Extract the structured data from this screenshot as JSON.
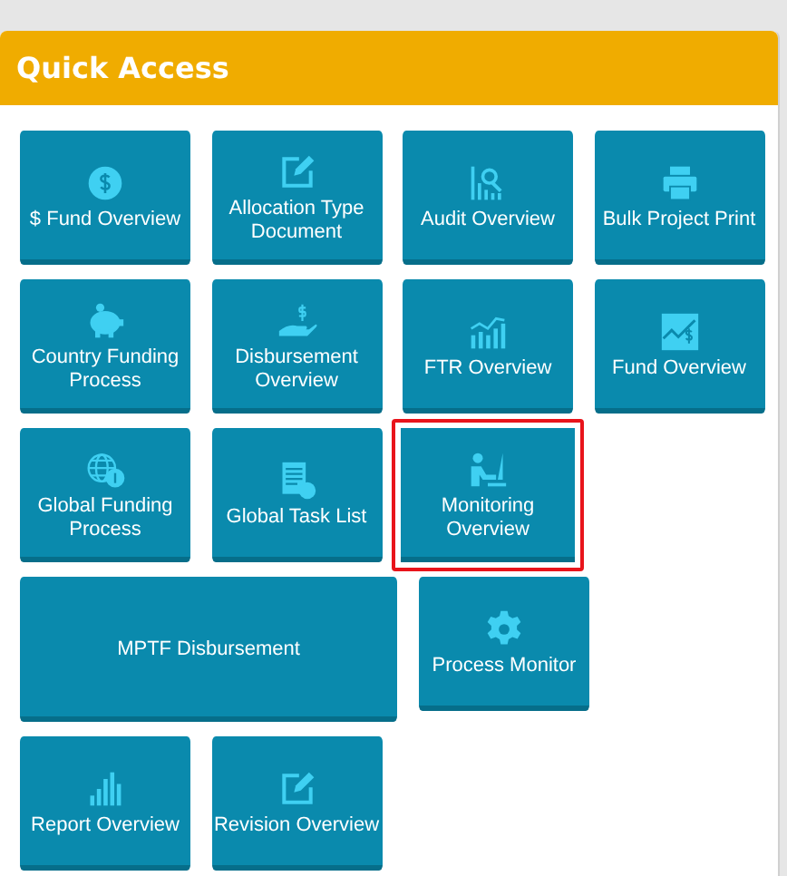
{
  "panel": {
    "title": "Quick Access"
  },
  "rows": [
    [
      {
        "label": "$ Fund Overview",
        "kind": "standard",
        "selected": false
      },
      {
        "label": "Allocation Type Document",
        "kind": "standard",
        "selected": false
      },
      {
        "label": "Audit Overview",
        "kind": "standard",
        "selected": false
      },
      {
        "label": "Bulk Project Print",
        "kind": "standard",
        "selected": false
      }
    ],
    [
      {
        "label": "Country Funding Process",
        "kind": "standard",
        "selected": false
      },
      {
        "label": "Disbursement Overview",
        "kind": "standard",
        "selected": false
      },
      {
        "label": "FTR Overview",
        "kind": "standard",
        "selected": false
      },
      {
        "label": "Fund Overview",
        "kind": "standard",
        "selected": false
      }
    ],
    [
      {
        "label": "Global Funding Process",
        "kind": "standard",
        "selected": false
      },
      {
        "label": "Global Task List",
        "kind": "standard",
        "selected": false
      },
      {
        "label": "Monitoring Overview",
        "kind": "standard",
        "selected": true
      }
    ],
    [
      {
        "label": "MPTF Disbursement",
        "kind": "wide",
        "selected": false
      },
      {
        "label": "Process Monitor",
        "kind": "standard",
        "selected": false
      }
    ],
    [
      {
        "label": "Report Overview",
        "kind": "standard",
        "selected": false
      },
      {
        "label": "Revision Overview",
        "kind": "standard",
        "selected": false
      }
    ]
  ]
}
